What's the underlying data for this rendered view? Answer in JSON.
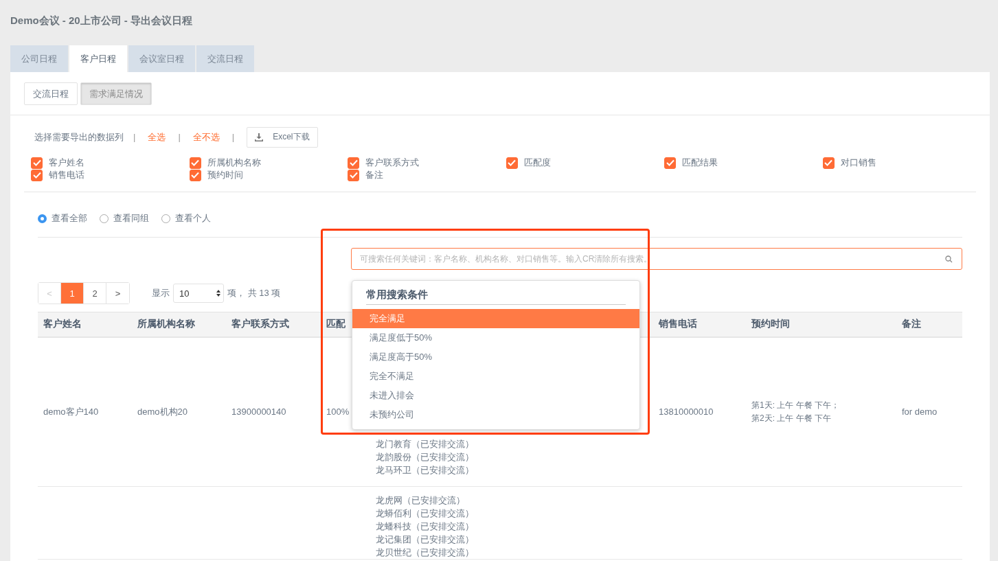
{
  "page_title": "Demo会议 - 20上市公司 - 导出会议日程",
  "tabs": [
    {
      "label": "公司日程",
      "selected": false
    },
    {
      "label": "客户日程",
      "selected": true
    },
    {
      "label": "会议室日程",
      "selected": false
    },
    {
      "label": "交流日程",
      "selected": false
    }
  ],
  "sub_tabs": [
    {
      "label": "交流日程",
      "selected": false
    },
    {
      "label": "需求满足情况",
      "selected": true
    }
  ],
  "export": {
    "label": "选择需要导出的数据列",
    "separator": "|",
    "select_all": "全选",
    "select_none": "全不选",
    "download_button": "Excel下载"
  },
  "columns_checklist": [
    {
      "label": "客户姓名",
      "checked": true
    },
    {
      "label": "所属机构名称",
      "checked": true
    },
    {
      "label": "客户联系方式",
      "checked": true
    },
    {
      "label": "匹配度",
      "checked": true
    },
    {
      "label": "匹配结果",
      "checked": true
    },
    {
      "label": "对口销售",
      "checked": true
    },
    {
      "label": "销售电话",
      "checked": true
    },
    {
      "label": "预约时间",
      "checked": true
    },
    {
      "label": "备注",
      "checked": true
    }
  ],
  "view_options": [
    {
      "label": "查看全部",
      "selected": true
    },
    {
      "label": "查看同组",
      "selected": false
    },
    {
      "label": "查看个人",
      "selected": false
    }
  ],
  "search": {
    "placeholder": "可搜索任何关键词：客户名称、机构名称、对口销售等。输入CR清除所有搜索。"
  },
  "search_suggestions": {
    "title": "常用搜索条件",
    "items": [
      {
        "label": "完全满足",
        "selected": true
      },
      {
        "label": "满足度低于50%",
        "selected": false
      },
      {
        "label": "满足度高于50%",
        "selected": false
      },
      {
        "label": "完全不满足",
        "selected": false
      },
      {
        "label": "未进入排会",
        "selected": false
      },
      {
        "label": "未预约公司",
        "selected": false
      }
    ]
  },
  "pagination": {
    "pages": [
      {
        "label": "<",
        "selected": false,
        "disabled": true
      },
      {
        "label": "1",
        "selected": true,
        "disabled": false
      },
      {
        "label": "2",
        "selected": false,
        "disabled": false
      },
      {
        "label": ">",
        "selected": false,
        "disabled": false
      }
    ],
    "show_label": "显示",
    "page_size": "10",
    "summary": "项， 共 13 项"
  },
  "table": {
    "columns_left": [
      "客户姓名",
      "所属机构名称",
      "客户联系方式",
      "匹配"
    ],
    "columns_right": [
      "销售电话",
      "预约时间",
      "备注"
    ],
    "rows": [
      {
        "customer": "demo客户140",
        "org": "demo机构20",
        "contact": "13900000140",
        "match": "100%",
        "results": [
          "龙门教育（已安排交流）",
          "龙韵股份（已安排交流）",
          "龙马环卫（已安排交流）"
        ],
        "sales_phone": "13810000010",
        "time": [
          "第1天: 上午 午餐 下午；",
          "第2天: 上午 午餐 下午"
        ],
        "note": "for demo"
      },
      {
        "results": [
          "龙虎网（已安排交流）",
          "龙蟒佰利（已安排交流）",
          "龙蟠科技（已安排交流）",
          "龙记集团（已安排交流）",
          "龙贝世纪（已安排交流）"
        ]
      }
    ]
  }
}
